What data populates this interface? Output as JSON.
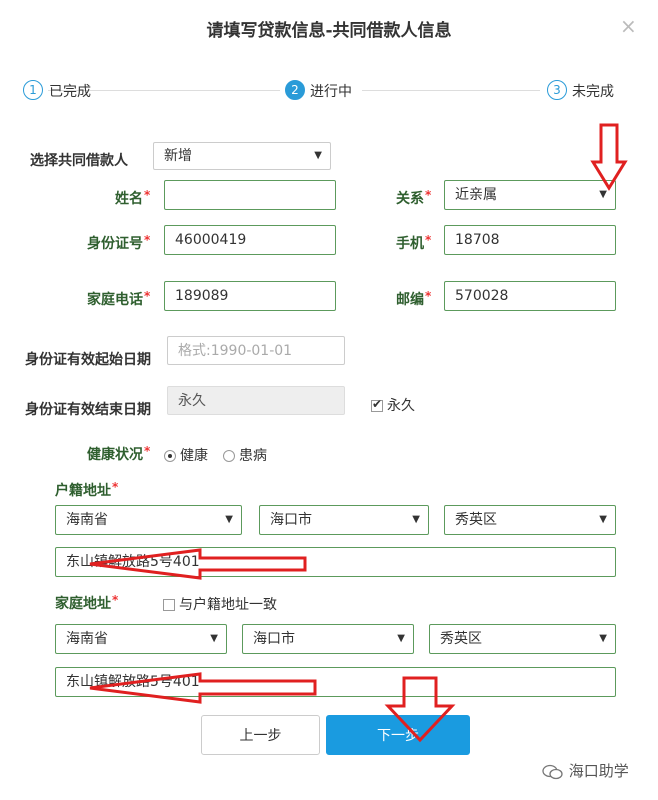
{
  "dialog": {
    "title": "请填写贷款信息-共同借款人信息",
    "close_glyph": "×"
  },
  "steps": [
    {
      "num": "1",
      "label": "已完成"
    },
    {
      "num": "2",
      "label": "进行中"
    },
    {
      "num": "3",
      "label": "未完成"
    }
  ],
  "form": {
    "co_borrower": {
      "label": "选择共同借款人",
      "value": "新增"
    },
    "name": {
      "label": "姓名",
      "value": ""
    },
    "relation": {
      "label": "关系",
      "value": "近亲属"
    },
    "id_number": {
      "label": "身份证号",
      "value": "46000419"
    },
    "mobile": {
      "label": "手机",
      "value": "18708"
    },
    "home_phone": {
      "label": "家庭电话",
      "value": "189089"
    },
    "postcode": {
      "label": "邮编",
      "value": "570028"
    },
    "id_start": {
      "label": "身份证有效起始日期",
      "placeholder": "格式:1990-01-01"
    },
    "id_end": {
      "label": "身份证有效结束日期",
      "value": "永久",
      "permanent_label": "永久"
    },
    "health": {
      "label": "健康状况",
      "options": [
        "健康",
        "患病"
      ],
      "selected": "健康"
    },
    "hukou": {
      "label": "户籍地址",
      "province": "海南省",
      "city": "海口市",
      "district": "秀英区",
      "detail": "东山镇解放路5号401"
    },
    "home": {
      "label": "家庭地址",
      "same_as_hukou": "与户籍地址一致",
      "province": "海南省",
      "city": "海口市",
      "district": "秀英区",
      "detail": "东山镇解放路5号401"
    },
    "required_mark": "*",
    "select_arrow": "▼"
  },
  "buttons": {
    "prev": "上一步",
    "next": "下一步"
  },
  "watermark": "海口助学",
  "colors": {
    "accent": "#1a9be0",
    "label_green": "#2f5f2f",
    "field_border": "#5c9a5c",
    "annotation_red": "#e02020"
  }
}
